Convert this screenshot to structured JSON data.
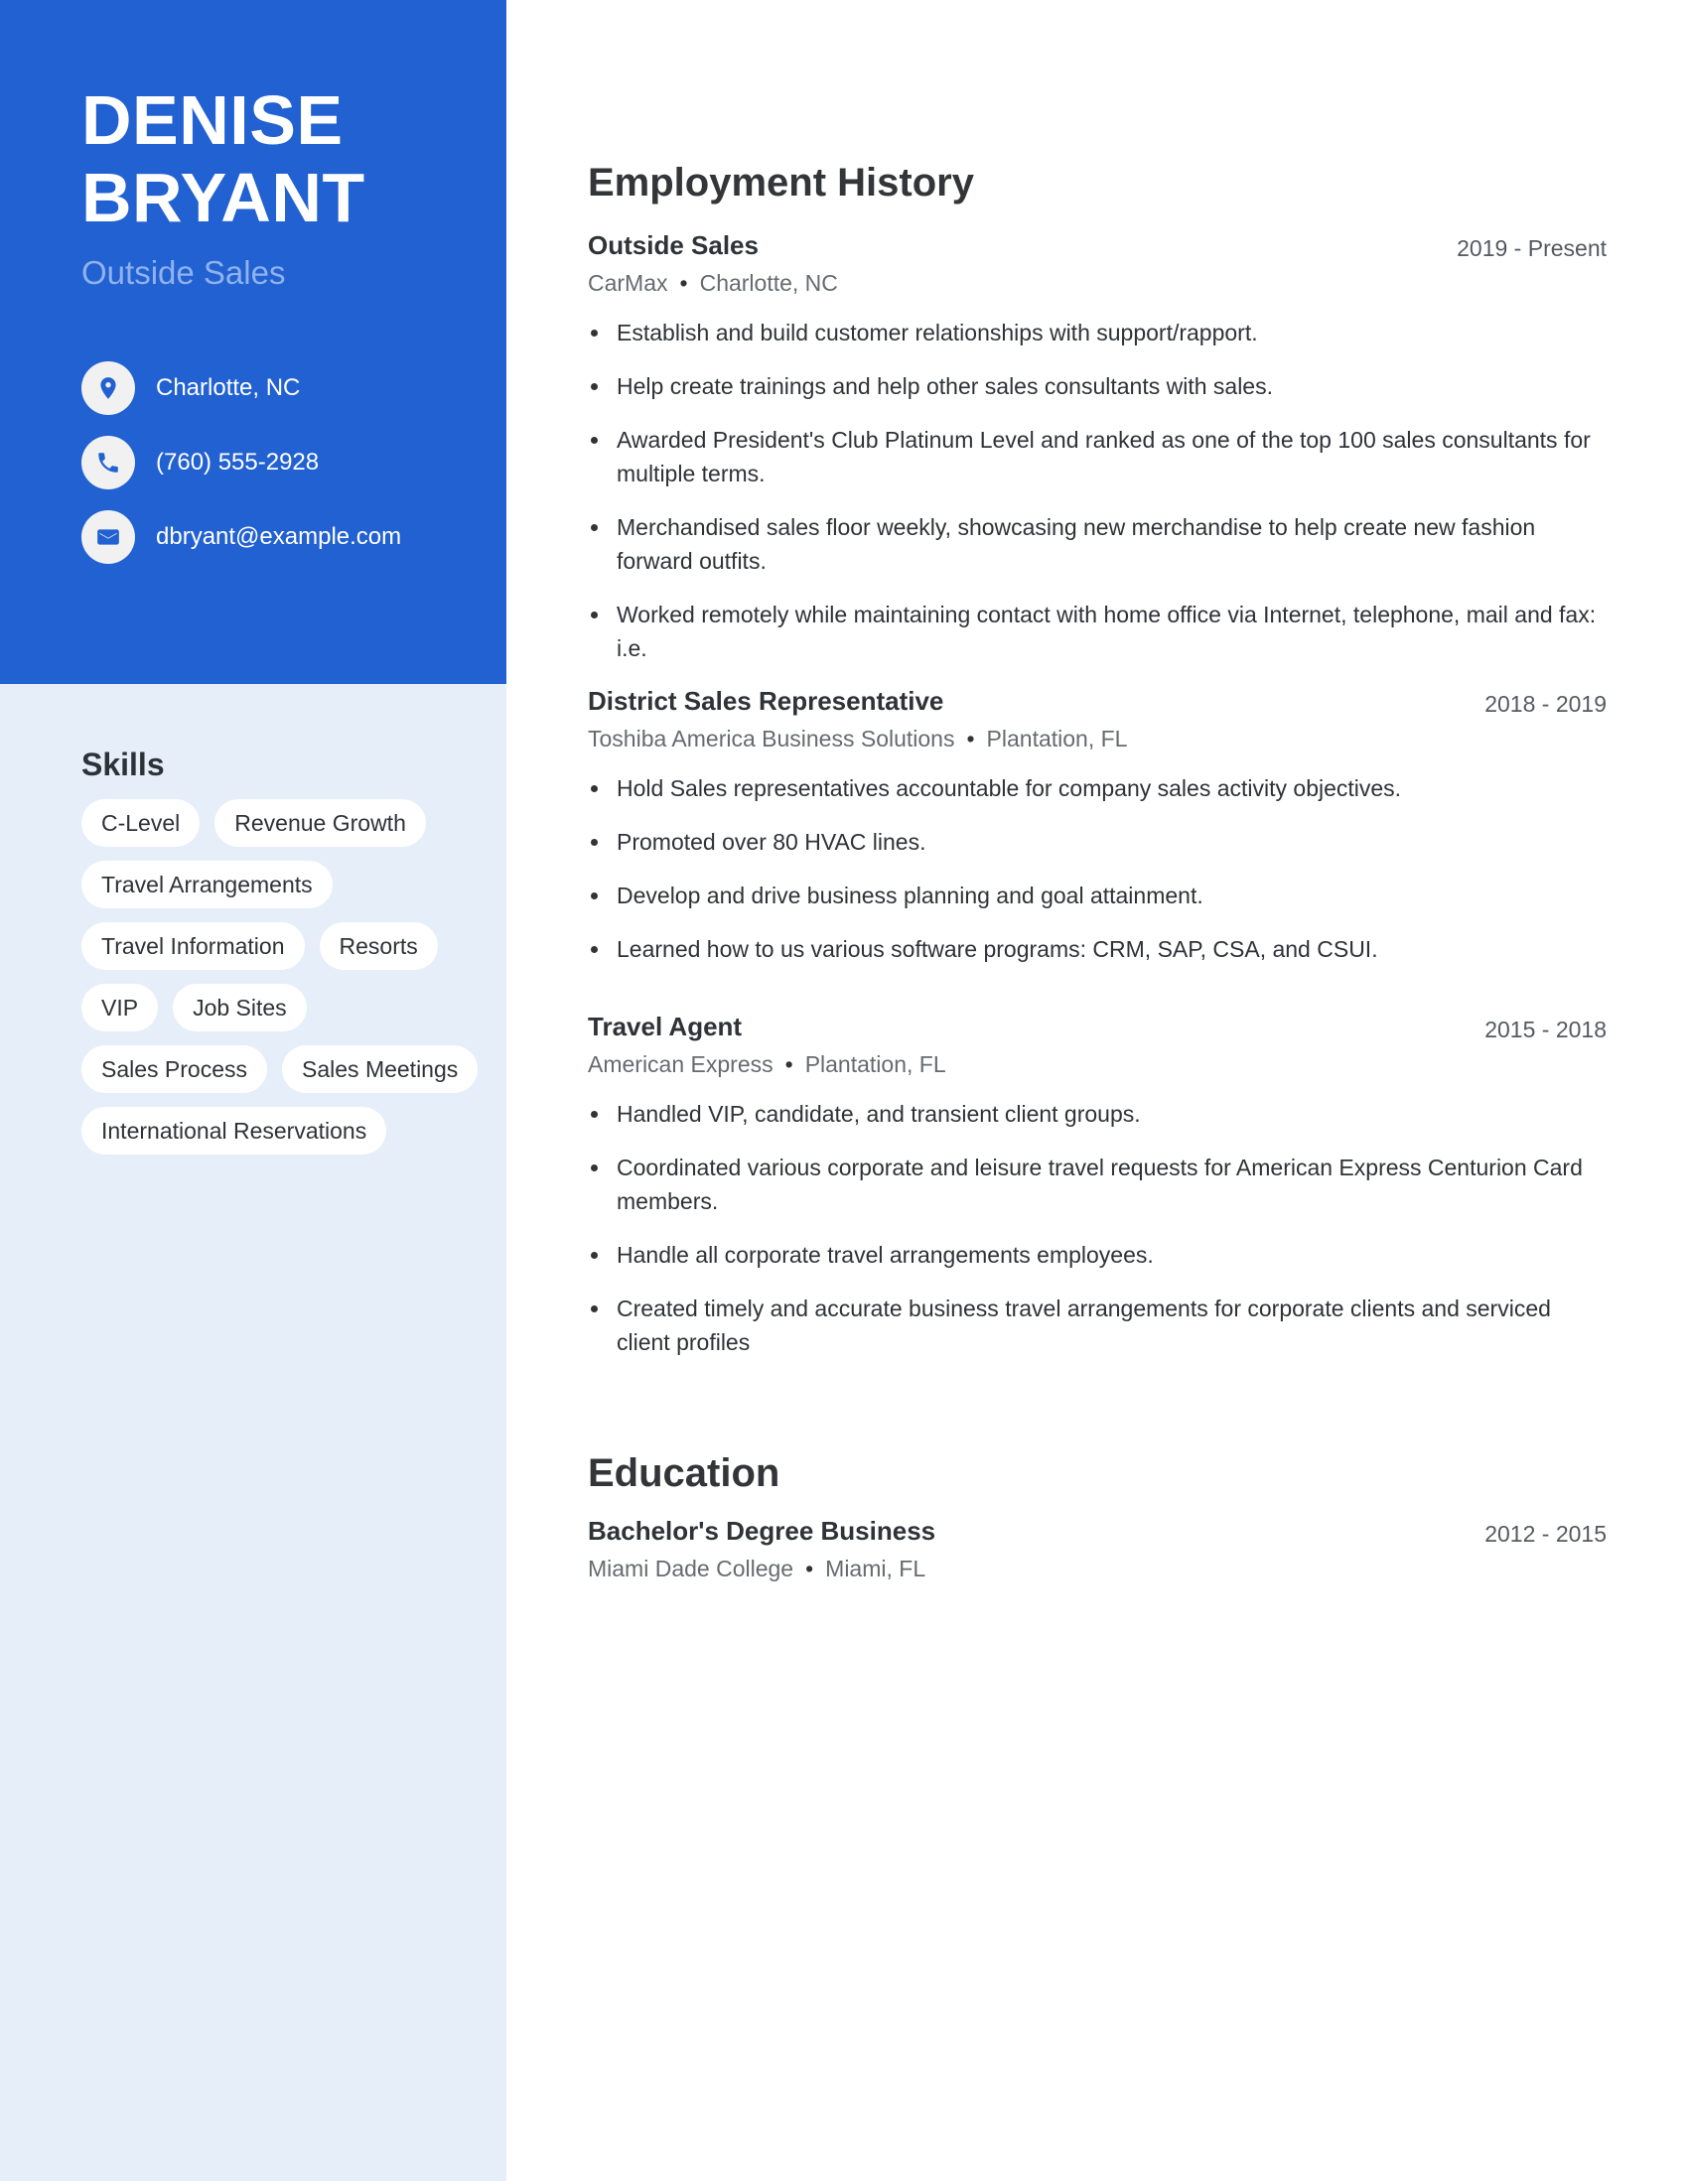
{
  "colors": {
    "sidebar_accent": "#2261d1",
    "sidebar_light": "#e6eef9",
    "role_text": "#8fb2ee"
  },
  "profile": {
    "first_name": "DENISE",
    "last_name": "BRYANT",
    "role": "Outside Sales"
  },
  "contact": {
    "location": {
      "icon": "map-pin-icon",
      "text": "Charlotte, NC"
    },
    "phone": {
      "icon": "phone-icon",
      "text": "(760) 555-2928"
    },
    "email": {
      "icon": "mail-icon",
      "text": "dbryant@example.com"
    }
  },
  "skills": {
    "title": "Skills",
    "items": [
      "C-Level",
      "Revenue Growth",
      "Travel Arrangements",
      "Travel Information",
      "Resorts",
      "VIP",
      "Job Sites",
      "Sales Process",
      "Sales Meetings",
      "International Reservations"
    ]
  },
  "employment": {
    "title": "Employment History",
    "jobs": [
      {
        "title": "Outside Sales",
        "dates": "2019 - Present",
        "company": "CarMax",
        "location": "Charlotte, NC",
        "bullets": [
          "Establish and build customer relationships with support/rapport.",
          "Help create trainings and help other sales consultants with sales.",
          "Awarded President's Club Platinum Level and ranked as one of the top 100 sales consultants for multiple terms.",
          "Merchandised sales floor weekly, showcasing new merchandise to help create new fashion forward outfits.",
          "Worked remotely while maintaining contact with home office via Internet, telephone, mail and fax: i.e."
        ]
      },
      {
        "title": "District Sales Representative",
        "dates": "2018 - 2019",
        "company": "Toshiba America Business Solutions",
        "location": "Plantation, FL",
        "bullets": [
          "Hold Sales representatives accountable for company sales activity objectives.",
          "Promoted over 80 HVAC lines.",
          "Develop and drive business planning and goal attainment.",
          "Learned how to us various software programs: CRM, SAP, CSA, and CSUI."
        ]
      },
      {
        "title": "Travel Agent",
        "dates": "2015 - 2018",
        "company": "American Express",
        "location": "Plantation, FL",
        "bullets": [
          "Handled VIP, candidate, and transient client groups.",
          "Coordinated various corporate and leisure travel requests for American Express Centurion Card members.",
          "Handle all corporate travel arrangements employees.",
          "Created timely and accurate business travel arrangements for corporate clients and serviced client profiles"
        ]
      }
    ]
  },
  "education": {
    "title": "Education",
    "items": [
      {
        "degree": "Bachelor's Degree Business",
        "dates": "2012 - 2015",
        "school": "Miami Dade College",
        "location": "Miami, FL"
      }
    ]
  },
  "separator": "•"
}
